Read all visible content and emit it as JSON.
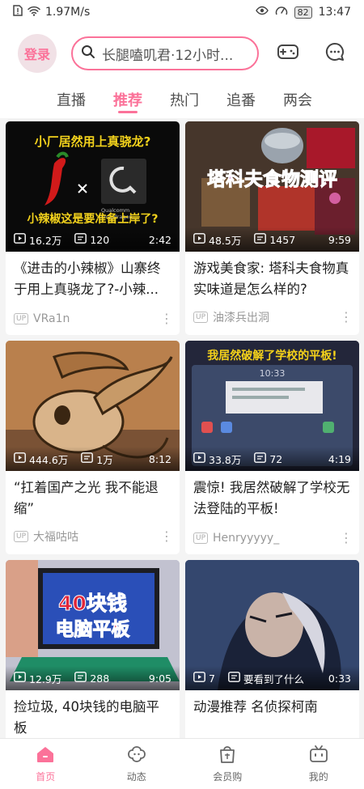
{
  "status_bar": {
    "speed": "1.97M/s",
    "battery": "82",
    "time": "13:47"
  },
  "header": {
    "login_label": "登录",
    "search_text": "长腿嗑叽君·12小时..."
  },
  "tabs": [
    {
      "label": "直播",
      "active": false
    },
    {
      "label": "推荐",
      "active": true
    },
    {
      "label": "热门",
      "active": false
    },
    {
      "label": "追番",
      "active": false
    },
    {
      "label": "两会",
      "active": false
    }
  ],
  "videos": [
    {
      "thumb_title": "小厂居然用上真骁龙?",
      "thumb_subtitle": "小辣椒这是要准备上岸了?",
      "thumb_brand": "Qualcomm snapdragon",
      "views": "16.2万",
      "danmaku": "120",
      "duration": "2:42",
      "title": "《进击的小辣椒》山寨终于用上真骁龙了?-小辣...",
      "uploader": "VRa1n"
    },
    {
      "thumb_title": "塔科夫食物测评",
      "views": "48.5万",
      "danmaku": "1457",
      "duration": "9:59",
      "title": "游戏美食家: 塔科夫食物真实味道是怎么样的?",
      "uploader": "油漆兵出洞"
    },
    {
      "views": "444.6万",
      "danmaku": "1万",
      "duration": "8:12",
      "title": "“扛着国产之光 我不能退缩”",
      "uploader": "大福咕咕"
    },
    {
      "thumb_title": "我居然破解了学校的平板!",
      "thumb_clock": "10:33",
      "views": "33.8万",
      "danmaku": "72",
      "duration": "4:19",
      "title": "震惊! 我居然破解了学校无法登陆的平板!",
      "uploader": "Henryyyyy_"
    },
    {
      "thumb_title": "40块钱",
      "thumb_subtitle": "电脑平板",
      "views": "12.9万",
      "danmaku": "288",
      "duration": "9:05",
      "title": "捡垃圾, 40块钱的电脑平板",
      "uploader": ""
    },
    {
      "views": "7",
      "danmaku": "要看到了什么",
      "duration": "0:33",
      "title": "动漫推荐 名侦探柯南",
      "uploader": ""
    }
  ],
  "bottom_nav": [
    {
      "label": "首页",
      "icon": "home-icon",
      "active": true
    },
    {
      "label": "动态",
      "icon": "activity-icon",
      "active": false
    },
    {
      "label": "会员购",
      "icon": "shopping-bag-icon",
      "active": false
    },
    {
      "label": "我的",
      "icon": "tv-icon",
      "active": false
    }
  ],
  "colors": {
    "accent": "#fb7299",
    "background": "#f4f4f4"
  }
}
